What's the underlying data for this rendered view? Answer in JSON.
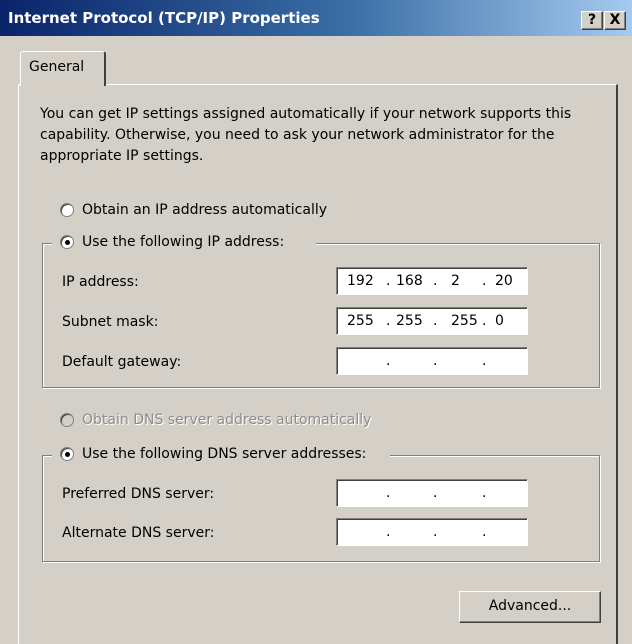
{
  "window": {
    "title": "Internet Protocol (TCP/IP) Properties",
    "help_label": "?",
    "close_label": "X"
  },
  "tabs": [
    {
      "label": "General"
    }
  ],
  "intro_text": "You can get IP settings assigned automatically if your network supports this capability. Otherwise, you need to ask your network administrator for the appropriate IP settings.",
  "ip_section": {
    "obtain_auto": {
      "label": "Obtain an IP address automatically",
      "checked": false
    },
    "use_following": {
      "label": "Use the following IP address:",
      "checked": true
    },
    "fields": [
      {
        "label": "IP address:",
        "octets": [
          "192",
          "168",
          "2",
          "20"
        ]
      },
      {
        "label": "Subnet mask:",
        "octets": [
          "255",
          "255",
          "255",
          "0"
        ]
      },
      {
        "label": "Default gateway:",
        "octets": [
          "",
          "",
          "",
          ""
        ]
      }
    ]
  },
  "dns_section": {
    "obtain_auto": {
      "label": "Obtain DNS server address automatically",
      "checked": false,
      "disabled": true
    },
    "use_following": {
      "label": "Use the following DNS server addresses:",
      "checked": true
    },
    "fields": [
      {
        "label": "Preferred DNS server:",
        "octets": [
          "",
          "",
          "",
          ""
        ]
      },
      {
        "label": "Alternate DNS server:",
        "octets": [
          "",
          "",
          "",
          ""
        ]
      }
    ]
  },
  "buttons": {
    "advanced_label": "Advanced..."
  },
  "octet_separator": "."
}
